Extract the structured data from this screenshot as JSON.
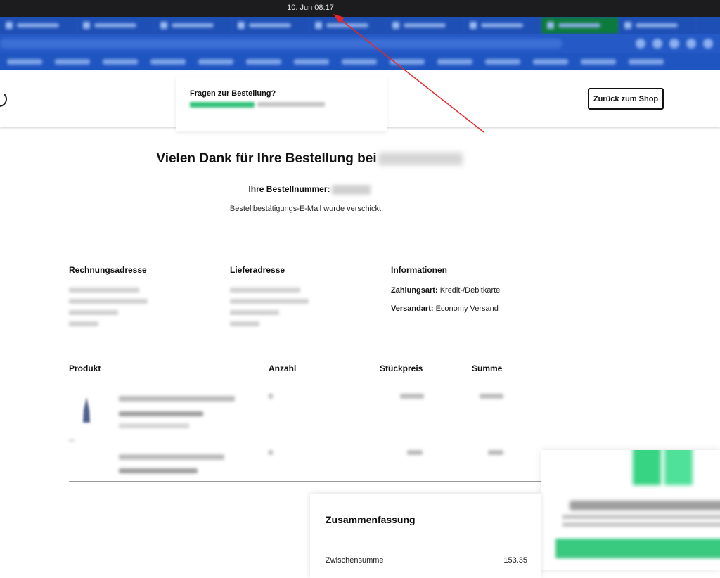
{
  "os": {
    "clock": "10. Jun  08:17"
  },
  "header": {
    "help_title": "Fragen zur Bestellung?",
    "back_button": "Zurück zum Shop"
  },
  "thanks": {
    "title": "Vielen Dank für Ihre Bestellung bei",
    "order_label": "Ihre Bestellnummer:",
    "mail_sent": "Bestellbestätigungs-E-Mail wurde verschickt."
  },
  "billing": {
    "title": "Rechnungsadresse"
  },
  "shipping": {
    "title": "Lieferadresse"
  },
  "info": {
    "title": "Informationen",
    "payment_label": "Zahlungsart:",
    "payment_value": "Kredit-/Debitkarte",
    "shipping_label": "Versandart:",
    "shipping_value": "Economy Versand"
  },
  "table": {
    "headers": [
      "Produkt",
      "Anzahl",
      "Stückpreis",
      "Summe"
    ]
  },
  "summary": {
    "title": "Zusammenfassung",
    "subtotal_label": "Zwischensumme",
    "subtotal_value": "153.35"
  },
  "colors": {
    "annotation_arrow": "#e8262b",
    "promo_green": "#37d483",
    "brand_blue": "#1e4fb5"
  }
}
